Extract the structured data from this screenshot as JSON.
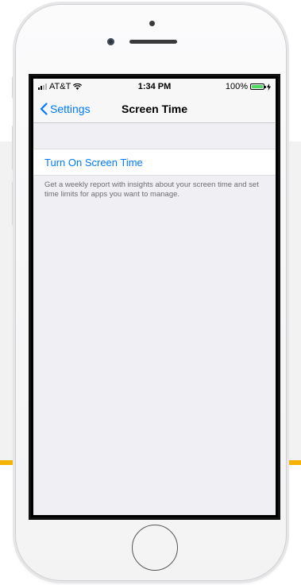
{
  "status_bar": {
    "carrier": "AT&T",
    "time": "1:34 PM",
    "battery_percent": "100%",
    "battery_level": 1.0,
    "signal_bars": 2,
    "icons": [
      "signal-bars-icon",
      "wifi-icon",
      "battery-icon",
      "charging-icon"
    ]
  },
  "nav": {
    "back_label": "Settings",
    "title": "Screen Time",
    "back_icon": "chevron-left-icon"
  },
  "content": {
    "turn_on_label": "Turn On Screen Time",
    "description": "Get a weekly report with insights about your screen time and set time limits for apps you want to manage."
  },
  "colors": {
    "accent": "#007aff",
    "battery": "#4cd964",
    "background_stripe": "#f4b400"
  }
}
